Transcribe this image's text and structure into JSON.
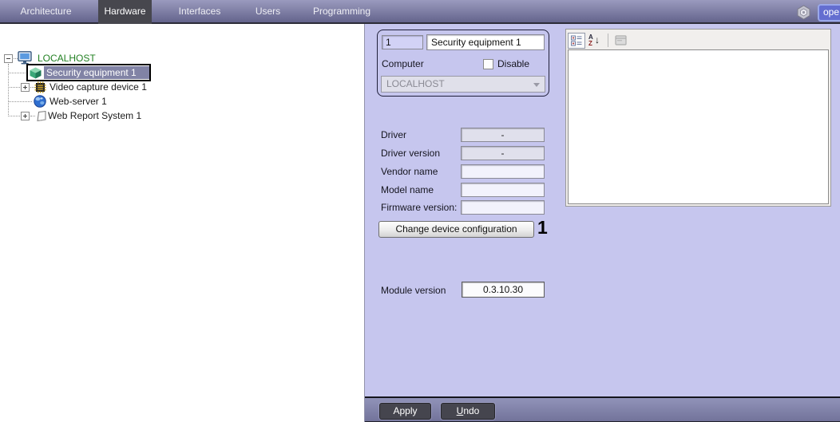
{
  "menu": {
    "tabs": [
      {
        "label": "Architecture"
      },
      {
        "label": "Hardware"
      },
      {
        "label": "Interfaces"
      },
      {
        "label": "Users"
      },
      {
        "label": "Programming"
      }
    ],
    "selected_tab": "Hardware",
    "corner_button_label": "ope"
  },
  "tree": {
    "root_label": "LOCALHOST",
    "items": [
      {
        "label": "Security equipment 1",
        "selected": true
      },
      {
        "label": "Video capture device 1",
        "expandable": true
      },
      {
        "label": "Web-server 1",
        "expandable": false
      },
      {
        "label": "Web Report System 1",
        "expandable": true
      }
    ]
  },
  "settings": {
    "id_value": "1",
    "name_value": "Security equipment 1",
    "computer_label": "Computer",
    "disable_label": "Disable",
    "disable_checked": false,
    "computer_value": "LOCALHOST",
    "rows": [
      {
        "label": "Driver",
        "value": "-"
      },
      {
        "label": "Driver version",
        "value": "-"
      },
      {
        "label": "Vendor name",
        "value": ""
      },
      {
        "label": "Model name",
        "value": ""
      },
      {
        "label": "Firmware version:",
        "value": ""
      }
    ],
    "change_button_label": "Change device configuration",
    "callout": "1",
    "module_version_label": "Module version",
    "module_version_value": "0.3.10.30"
  },
  "footer": {
    "apply_label": "Apply",
    "undo_label": "Undo"
  },
  "colors": {
    "panel_bg": "#c6c6ee",
    "menu_bar_top": "#9a9abe",
    "menu_selected": "#47474e",
    "tree_selection": "#8183a5",
    "root_label_green": "#228022",
    "footer_bar": "#7d7ea4",
    "footer_button": "#45454e"
  }
}
